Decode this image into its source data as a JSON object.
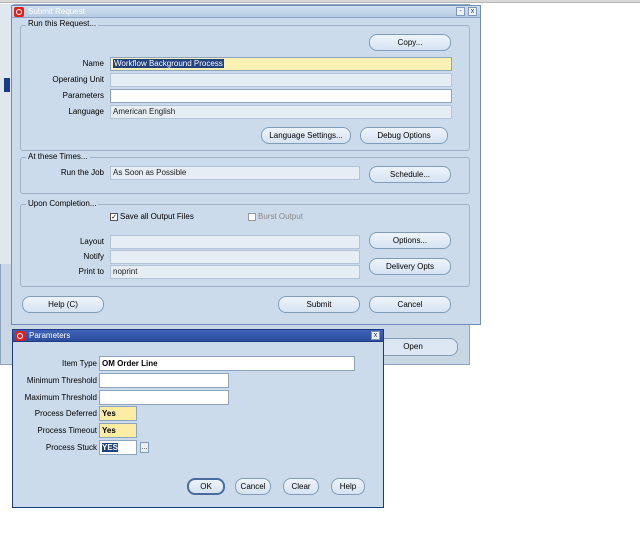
{
  "background_form": {
    "open_button": "Open"
  },
  "submit_request": {
    "title": "Submit Request",
    "controls": [
      "-",
      "x"
    ],
    "run_group": {
      "legend": "Run this Request...",
      "copy_button": "Copy...",
      "name_label": "Name",
      "name_value": "Workflow Background Process",
      "operating_unit_label": "Operating Unit",
      "operating_unit_value": "",
      "parameters_label": "Parameters",
      "parameters_value": "",
      "language_label": "Language",
      "language_value": "American English",
      "language_settings_button": "Language Settings...",
      "debug_options_button": "Debug Options"
    },
    "times_group": {
      "legend": "At these Times...",
      "run_job_label": "Run the Job",
      "run_job_value": "As Soon as Possible",
      "schedule_button": "Schedule..."
    },
    "completion_group": {
      "legend": "Upon Completion...",
      "save_output_label": "Save all Output Files",
      "save_output_checked": true,
      "burst_output_label": "Burst Output",
      "burst_output_checked": false,
      "layout_label": "Layout",
      "layout_value": "",
      "notify_label": "Notify",
      "notify_value": "",
      "print_to_label": "Print to",
      "print_to_value": "noprint",
      "options_button": "Options...",
      "delivery_button": "Delivery Opts"
    },
    "help_button": "Help (C)",
    "submit_button": "Submit",
    "cancel_button": "Cancel"
  },
  "parameters": {
    "title": "Parameters",
    "close": "x",
    "item_type_label": "Item Type",
    "item_type_value": "OM Order Line",
    "min_threshold_label": "Minimum Threshold",
    "min_threshold_value": "",
    "max_threshold_label": "Maximum Threshold",
    "max_threshold_value": "",
    "process_deferred_label": "Process Deferred",
    "process_deferred_value": "Yes",
    "process_timeout_label": "Process Timeout",
    "process_timeout_value": "Yes",
    "process_stuck_label": "Process Stuck",
    "process_stuck_value": "YES",
    "lov_glyph": "...",
    "ok_button": "OK",
    "cancel_button": "Cancel",
    "clear_button": "Clear",
    "help_button": "Help"
  }
}
